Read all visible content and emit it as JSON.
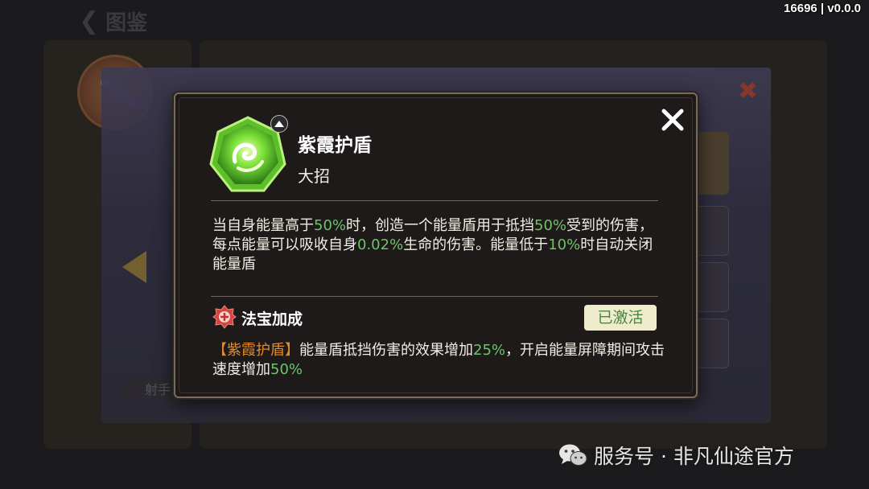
{
  "header": {
    "title": "图鉴",
    "version": "16696 | v0.0.0"
  },
  "background": {
    "tag_label": "射手"
  },
  "popup": {
    "skill_name": "紫霞护盾",
    "skill_type": "大招",
    "description": {
      "p1": "当自身能量高于",
      "v1": "50%",
      "p2": "时，创造一个能量盾用于抵挡",
      "v2": "50%",
      "p3": "受到的伤害，每点能量可以吸收自身",
      "v3": "0.02%",
      "p4": "生命的伤害。能量低于",
      "v4": "10%",
      "p5": "时自动关闭能量盾"
    },
    "treasure": {
      "title": "法宝加成",
      "status": "已激活",
      "bonus": {
        "ref": "【紫霞护盾】",
        "p1": "能量盾抵挡伤害的效果增加",
        "v1": "25%",
        "p2": "，开启能量屏障期间攻击速度增加",
        "v2": "50%"
      }
    }
  },
  "watermark": {
    "text": "服务号 · 非凡仙途官方"
  },
  "colors": {
    "highlight_green": "#6ec36a",
    "skill_ref_orange": "#e08a2a",
    "badge_bg": "#efeccd"
  },
  "icons": {
    "skill": "green-heptagon-skill-icon",
    "treasure": "red-seal-icon",
    "close": "close-icon",
    "upgrade": "chevron-up-icon"
  }
}
